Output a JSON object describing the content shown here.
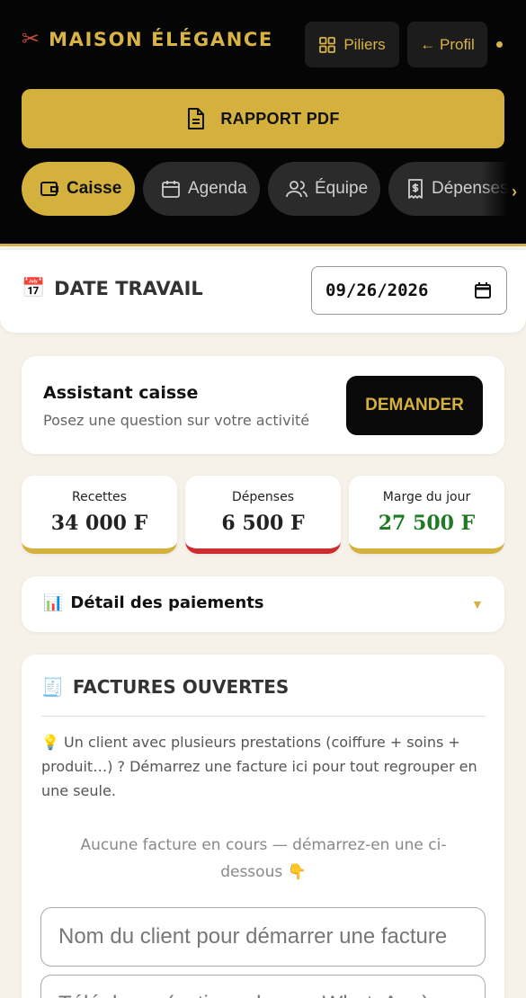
{
  "header": {
    "brand_icon": "scissors-icon",
    "brand": "MAISON ÉLÉGANCE",
    "piliers_label": "Piliers",
    "profil_label": "← Profil",
    "pdf_label": "RAPPORT PDF",
    "accent": "#d4b13d"
  },
  "tabs": [
    {
      "label": "Caisse",
      "icon": "wallet-icon",
      "active": true
    },
    {
      "label": "Agenda",
      "icon": "calendar-icon",
      "active": false
    },
    {
      "label": "Équipe",
      "icon": "users-icon",
      "active": false
    },
    {
      "label": "Dépenses",
      "icon": "receipt-icon",
      "active": false
    }
  ],
  "date_section": {
    "title": "DATE TRAVAIL",
    "icon": "📅",
    "value": "09/26/2026"
  },
  "assistant": {
    "title": "Assistant caisse",
    "subtitle": "Posez une question sur votre activité",
    "button": "DEMANDER"
  },
  "stats": [
    {
      "label": "Recettes",
      "value": "34 000 F",
      "color": "#d4b13d"
    },
    {
      "label": "Dépenses",
      "value": "6 500 F",
      "color": "#cc2e2e"
    },
    {
      "label": "Marge du jour",
      "value": "27 500 F",
      "color": "#1e7a24"
    }
  ],
  "payment_detail": {
    "icon": "📊",
    "title": "Détail des paiements",
    "chevron": "▼"
  },
  "invoices": {
    "icon": "🧾",
    "title": "FACTURES OUVERTES",
    "tip": "💡 Un client avec plusieurs prestations (coiffure + soins + produit…) ? Démarrez une facture ici pour tout regrouper en une seule.",
    "empty": "Aucune facture en cours — démarrez-en une ci-dessous 👇",
    "client_placeholder": "Nom du client pour démarrer une facture",
    "phone_placeholder": "Téléphone (optionnel, pour WhatsApp)"
  }
}
